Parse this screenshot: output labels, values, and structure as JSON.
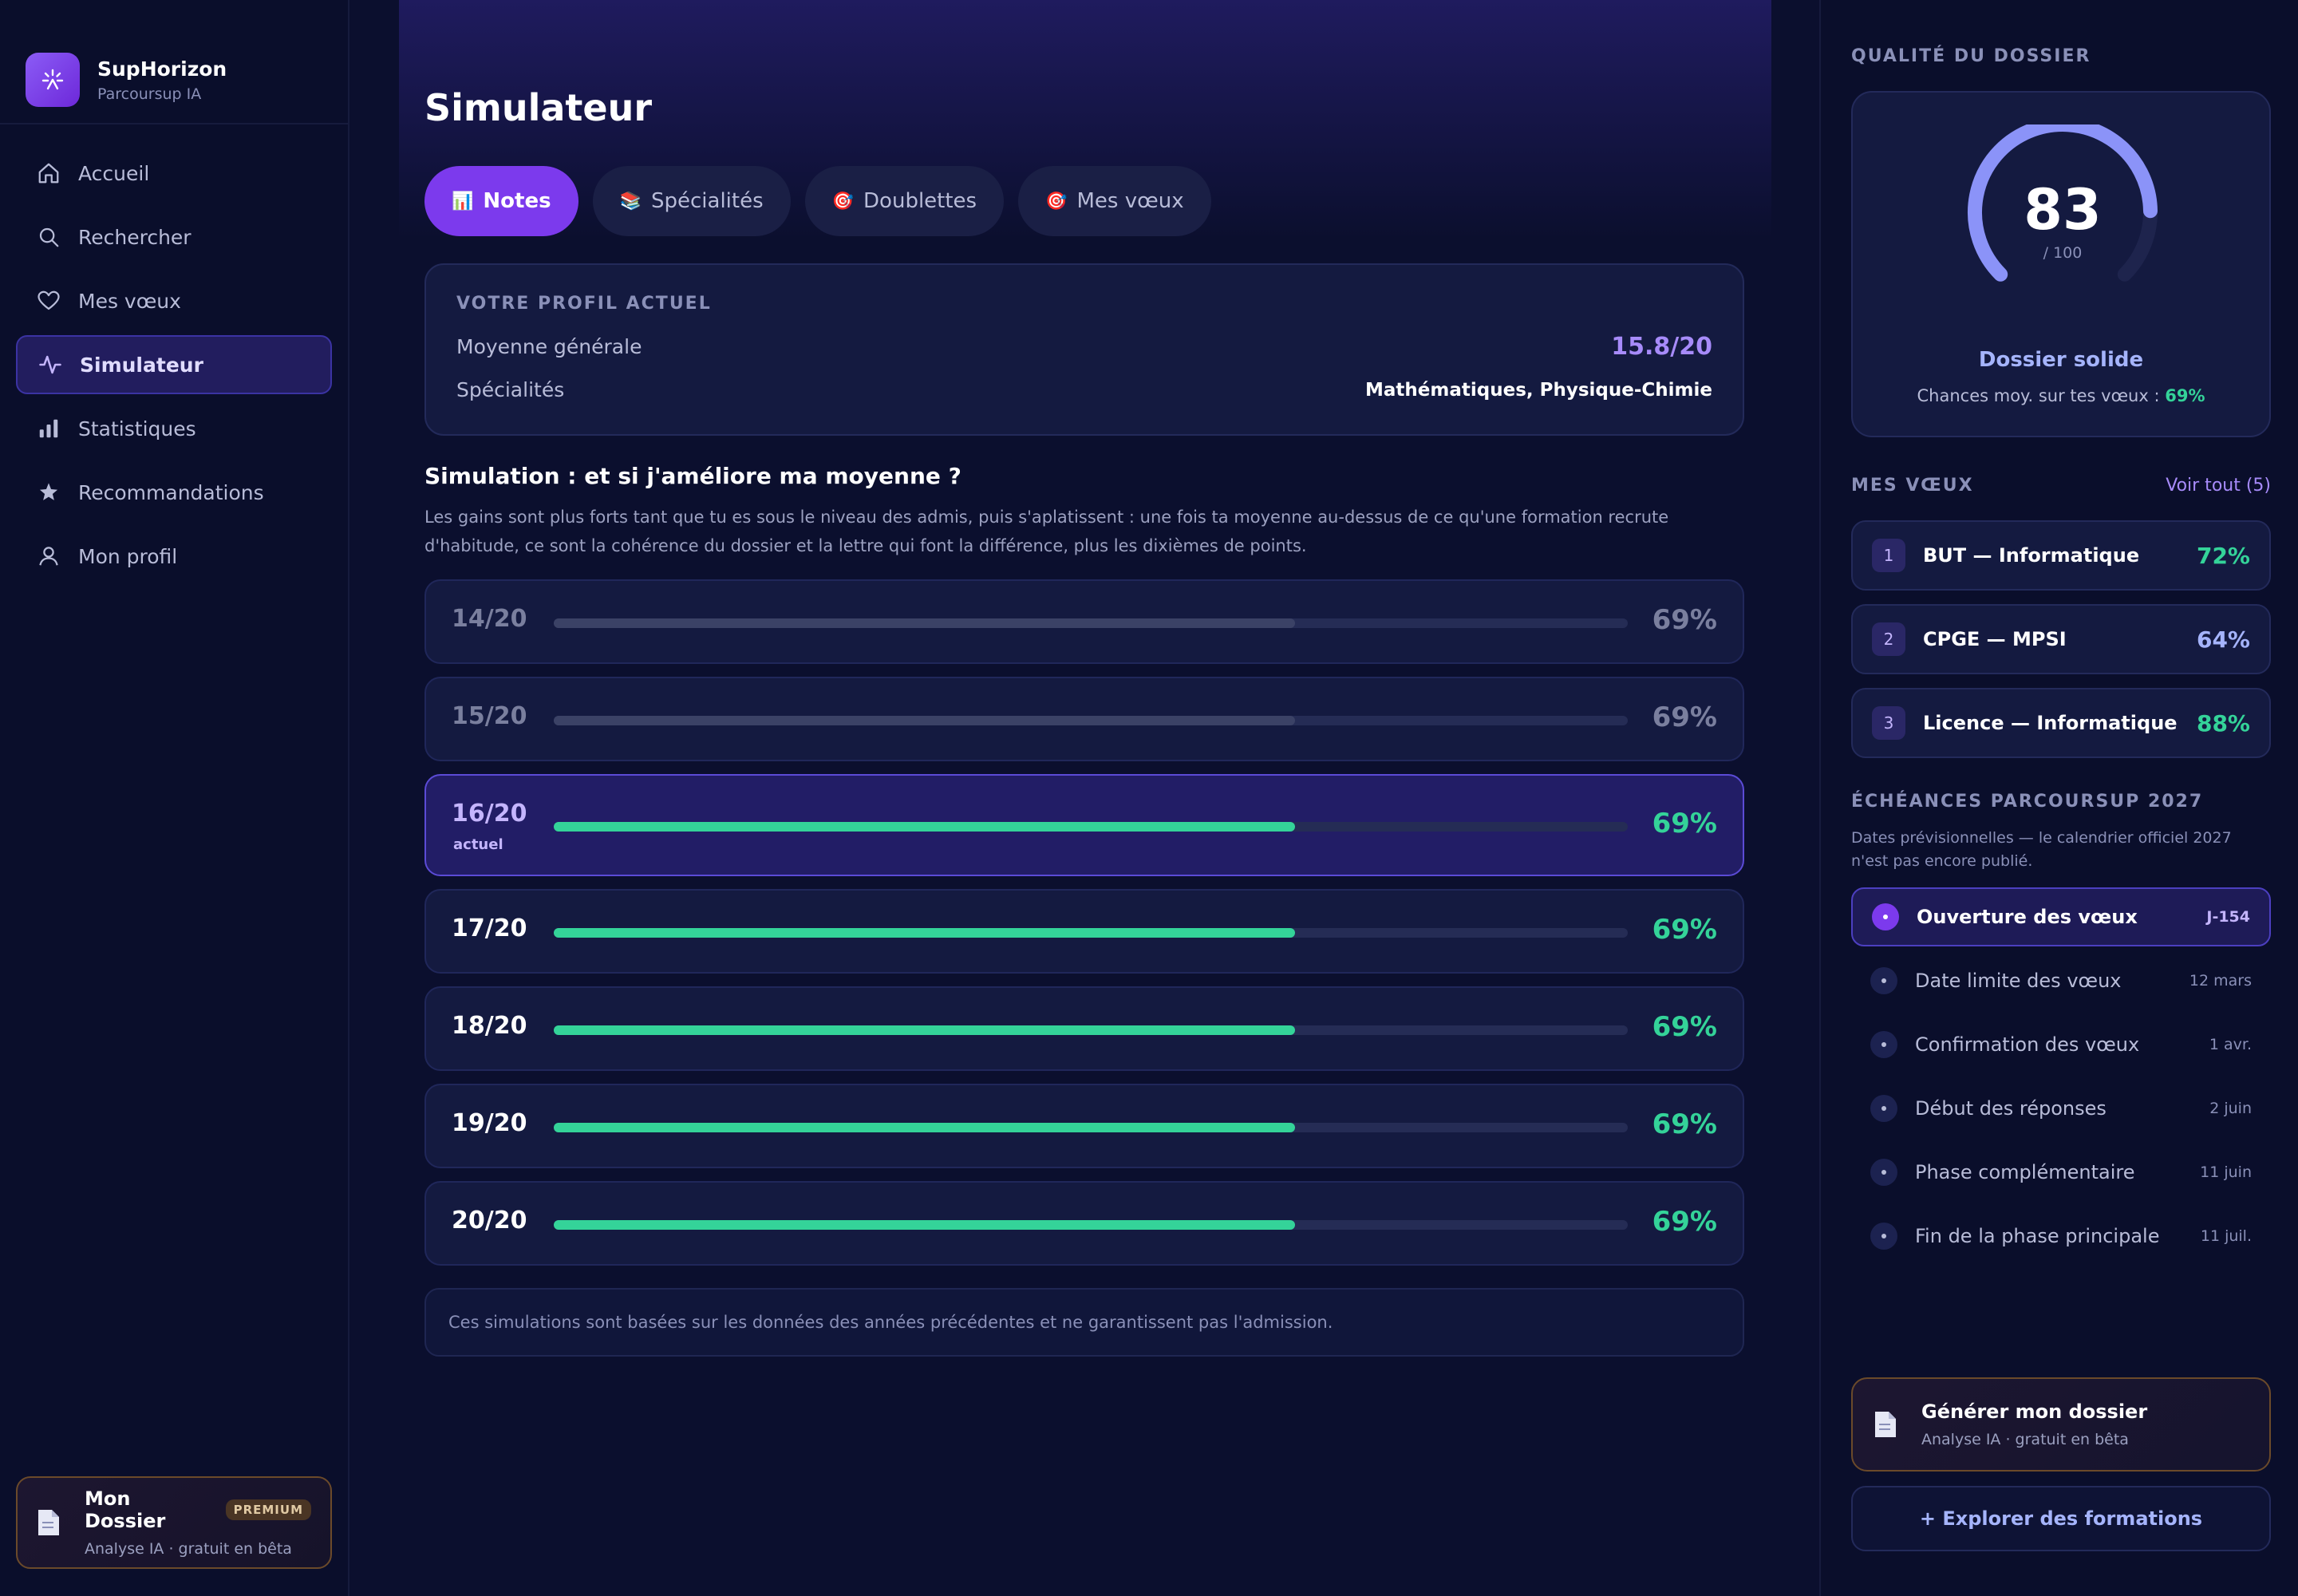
{
  "brand": {
    "name": "SupHorizon",
    "subtitle": "Parcoursup IA"
  },
  "nav": [
    {
      "label": "Accueil",
      "icon": "home-icon"
    },
    {
      "label": "Rechercher",
      "icon": "search-icon"
    },
    {
      "label": "Mes vœux",
      "icon": "heart-icon"
    },
    {
      "label": "Simulateur",
      "icon": "pulse-icon",
      "active": true
    },
    {
      "label": "Statistiques",
      "icon": "bar-chart-icon"
    },
    {
      "label": "Recommandations",
      "icon": "star-icon"
    },
    {
      "label": "Mon profil",
      "icon": "user-icon"
    }
  ],
  "sidebar_dossier": {
    "title": "Mon Dossier",
    "badge": "PREMIUM",
    "subtitle": "Analyse IA · gratuit en bêta"
  },
  "page_title": "Simulateur",
  "tabs": [
    {
      "label": "Notes",
      "icon": "📊",
      "active": true
    },
    {
      "label": "Spécialités",
      "icon": "📚"
    },
    {
      "label": "Doublettes",
      "icon": "🎯"
    },
    {
      "label": "Mes vœux",
      "icon": "🎯"
    }
  ],
  "profile": {
    "section_label": "VOTRE PROFIL ACTUEL",
    "average_label": "Moyenne générale",
    "average_value": "15.8/20",
    "specialties_label": "Spécialités",
    "specialties_value": "Mathématiques, Physique-Chimie"
  },
  "simulation": {
    "title": "Simulation : et si j'améliore ma moyenne ?",
    "description": "Les gains sont plus forts tant que tu es sous le niveau des admis, puis s'aplatissent : une fois ta moyenne au-dessus de ce qu'une formation recrute d'habitude, ce sont la cohérence du dossier et la lettre qui font la différence, plus les dixièmes de points.",
    "rows": [
      {
        "grade": "14/20",
        "pct_label": "69%",
        "value": 0.69,
        "state": "below"
      },
      {
        "grade": "15/20",
        "pct_label": "69%",
        "value": 0.69,
        "state": "below"
      },
      {
        "grade": "16/20",
        "pct_label": "69%",
        "value": 0.69,
        "state": "current",
        "note": "actuel"
      },
      {
        "grade": "17/20",
        "pct_label": "69%",
        "value": 0.69,
        "state": "above"
      },
      {
        "grade": "18/20",
        "pct_label": "69%",
        "value": 0.69,
        "state": "above"
      },
      {
        "grade": "19/20",
        "pct_label": "69%",
        "value": 0.69,
        "state": "above"
      },
      {
        "grade": "20/20",
        "pct_label": "69%",
        "value": 0.69,
        "state": "above"
      }
    ],
    "disclaimer": "Ces simulations sont basées sur les données des années précédentes et ne garantissent pas l'admission."
  },
  "quality": {
    "label": "QUALITÉ DU DOSSIER",
    "score": "83",
    "score_value": 83,
    "max": "/ 100",
    "status": "Dossier solide",
    "chances_prefix": "Chances moy. sur tes vœux : ",
    "chances_value": "69%"
  },
  "voeux": {
    "label": "MES VŒUX",
    "see_all": "Voir tout (5)",
    "items": [
      {
        "num": "1",
        "name": "BUT — Informatique",
        "pct": "72%",
        "color": "#34d399"
      },
      {
        "num": "2",
        "name": "CPGE — MPSI",
        "pct": "64%",
        "color": "#a5b4fc"
      },
      {
        "num": "3",
        "name": "Licence — Informatique",
        "pct": "88%",
        "color": "#34d399"
      }
    ]
  },
  "echeances": {
    "label": "ÉCHÉANCES PARCOURSUP 2027",
    "note": "Dates prévisionnelles — le calendrier officiel 2027 n'est pas encore publié.",
    "items": [
      {
        "name": "Ouverture des vœux",
        "date": "J-154",
        "active": true
      },
      {
        "name": "Date limite des vœux",
        "date": "12 mars"
      },
      {
        "name": "Confirmation des vœux",
        "date": "1 avr."
      },
      {
        "name": "Début des réponses",
        "date": "2 juin"
      },
      {
        "name": "Phase complémentaire",
        "date": "11 juin"
      },
      {
        "name": "Fin de la phase principale",
        "date": "11 juil."
      }
    ]
  },
  "generate": {
    "title": "Générer mon dossier",
    "subtitle": "Analyse IA · gratuit en bêta"
  },
  "explore_label": "+ Explorer des formations",
  "colors": {
    "accent": "#7c3aed",
    "success": "#34d399",
    "bg": "#0b0f2e"
  }
}
